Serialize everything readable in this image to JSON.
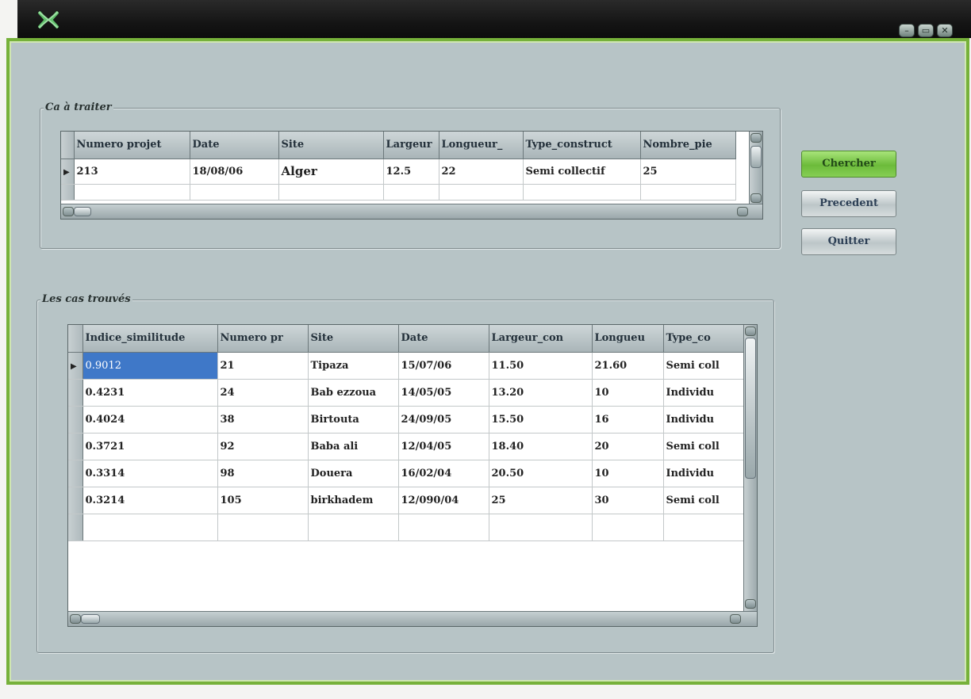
{
  "window": {
    "controls": [
      "minimize-icon",
      "maximize-icon",
      "close-icon"
    ]
  },
  "groups": {
    "to_process": "Ca à traiter",
    "found_cases": "Les cas trouvés"
  },
  "buttons": {
    "search": "Chercher",
    "previous": "Precedent",
    "quit": "Quitter"
  },
  "top_grid": {
    "columns": [
      "Numero projet",
      "Date",
      "Site",
      "Largeur",
      "Longueur_",
      "Type_construct",
      "Nombre_pie"
    ],
    "rows": [
      [
        "213",
        "18/08/06",
        "Alger",
        "12.5",
        "22",
        "Semi collectif",
        "25"
      ]
    ]
  },
  "bottom_grid": {
    "columns": [
      "Indice_similitude",
      "Numero pr",
      "Site",
      "Date",
      "Largeur_con",
      "Longueu",
      "Type_co"
    ],
    "rows": [
      [
        "0.9012",
        "21",
        "Tipaza",
        "15/07/06",
        "11.50",
        "21.60",
        "Semi coll"
      ],
      [
        "0.4231",
        "24",
        "Bab ezzoua",
        "14/05/05",
        "13.20",
        "10",
        "Individu"
      ],
      [
        "0.4024",
        "38",
        "Birtouta",
        "24/09/05",
        "15.50",
        "16",
        "Individu"
      ],
      [
        "0.3721",
        "92",
        "Baba ali",
        "12/04/05",
        "18.40",
        "20",
        "Semi coll"
      ],
      [
        "0.3314",
        "98",
        "Douera",
        "16/02/04",
        "20.50",
        "10",
        "Individu"
      ],
      [
        "0.3214",
        "105",
        "birkhadem",
        "12/090/04",
        "25",
        "30",
        "Semi coll"
      ]
    ]
  },
  "colors": {
    "accent_green": "#76b13a",
    "window_bg": "#b7c4c6",
    "selection": "#3f78c8"
  }
}
